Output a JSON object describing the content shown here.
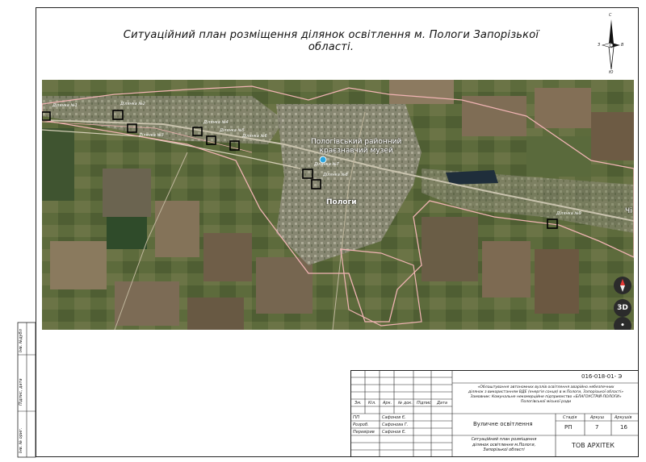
{
  "title": "Ситуаційний план розміщення ділянок освітлення м. Пологи Запорізької області.",
  "compass": {
    "north": "С",
    "south": "Ю",
    "west": "З",
    "east": "В"
  },
  "map": {
    "museum_label_line1": "Пологівський районний",
    "museum_label_line2": "краєзнавчий музей",
    "city_label": "Пологи",
    "edge_label": "Чі",
    "plots": [
      {
        "label": "Ділянка №1"
      },
      {
        "label": "Ділянка №2"
      },
      {
        "label": "Ділянка №3"
      },
      {
        "label": "Ділянка №4"
      },
      {
        "label": "Ділянка №5"
      },
      {
        "label": "Ділянка №6"
      },
      {
        "label": "Ділянка №7"
      },
      {
        "label": "Ділянка №8"
      },
      {
        "label": "Ділянка №9"
      }
    ],
    "controls": {
      "compass": "compass-control-icon",
      "three_d": "3D",
      "dot": "•"
    }
  },
  "stamp": {
    "doc_code": "016-018-01- Э",
    "project_name_line1": "«Облаштування автономних вузлів освітлення аварійно небезпечних",
    "project_name_line2": "ділянок з використанням ВДЕ (енергія сонця) в м.Пологи, Запорізької області»",
    "project_name_line3": "Замовник: Комунальне некомерційне підприємство «БЛАГОУСТРІЙ-ПОЛОГИ»",
    "project_name_line4": "Пологівської міської ради",
    "col_headers": [
      "Зм.",
      "Кіл.",
      "Арк.",
      "№ док.",
      "Підпис",
      "Дата"
    ],
    "roles": [
      {
        "role": "ГІП",
        "name": "Сафонов Є."
      },
      {
        "role": "Розроб.",
        "name": "Сафонова Г."
      },
      {
        "role": "Перевірив",
        "name": "Сафонов Є."
      }
    ],
    "section": "Вуличне освітлення",
    "stage_label": "Стадія",
    "sheet_label": "Аркуш",
    "sheets_label": "Аркушів",
    "stage": "РП",
    "sheet": "7",
    "sheets": "16",
    "drawing_title_line1": "Ситуаційний план розміщення",
    "drawing_title_line2": "ділянок освітлення м.Пологи,",
    "drawing_title_line3": "Запорізької області",
    "company": "ТОВ АРХІТЕК"
  },
  "side_labels": [
    "Інв. №дубл",
    "Підпис, дата",
    "Інв. № ориг."
  ]
}
